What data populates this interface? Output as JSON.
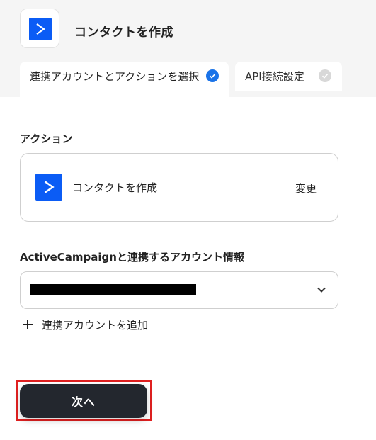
{
  "app": {
    "title": "コンタクトを作成",
    "icon": "activecampaign-logo",
    "brand_color": "#0b5cf5"
  },
  "tabs": [
    {
      "label": "連携アカウントとアクションを選択",
      "status": "complete",
      "icon": "check-circle-icon",
      "color": "#1a73e8"
    },
    {
      "label": "API接続設定",
      "status": "pending",
      "icon": "check-circle-icon",
      "color": "#d8d8d8"
    }
  ],
  "action_section": {
    "label": "アクション",
    "action_name": "コンタクトを作成",
    "change_label": "変更"
  },
  "account_section": {
    "label": "ActiveCampaignと連携するアカウント情報",
    "selected_value": "redacted account",
    "add_account_label": "連携アカウントを追加"
  },
  "footer": {
    "next_label": "次へ",
    "highlight_color": "#e02020"
  }
}
